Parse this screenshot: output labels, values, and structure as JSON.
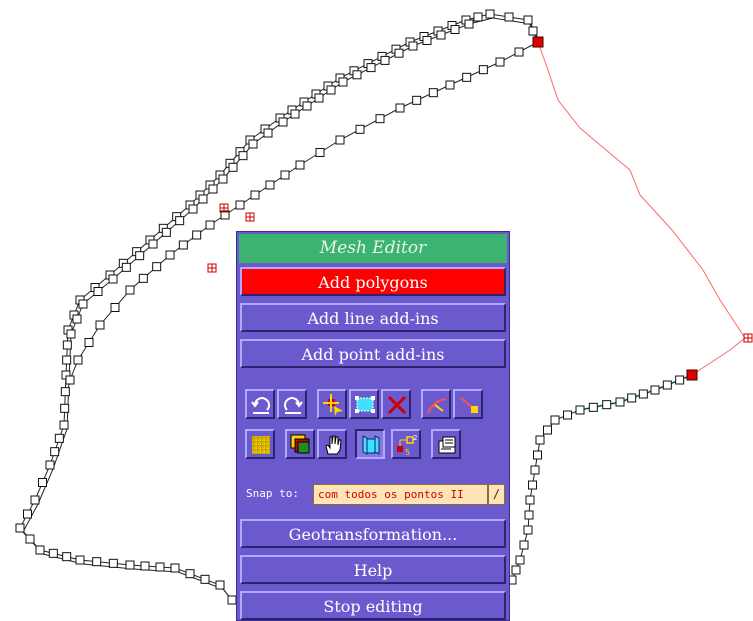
{
  "panel": {
    "title": "Mesh Editor",
    "buttons": {
      "add_polygons": "Add polygons",
      "add_line_addins": "Add line add-ins",
      "add_point_addins": "Add point add-ins",
      "geotransformation": "Geotransformation...",
      "help": "Help",
      "stop_editing": "Stop editing"
    },
    "snap": {
      "label": "Snap to:",
      "value": "com todos os pontos II",
      "dropdown_glyph": "/"
    }
  },
  "toolbar_row1": [
    "undo-icon",
    "redo-icon",
    "move-vertex-icon",
    "select-vertices-icon",
    "delete-icon",
    "split-line-icon",
    "delete-vertex-icon"
  ],
  "toolbar_row2": [
    "grid-icon",
    "overlay-icon",
    "pan-hand-icon",
    "mesh-view-icon",
    "number-nodes-icon",
    "properties-icon"
  ],
  "colors": {
    "panel_bg": "#6a5acd",
    "title_bg": "#3cb371",
    "active_button": "#ff0000",
    "boundary_line": "#ff6666",
    "cyan_line": "#40e0ff"
  }
}
